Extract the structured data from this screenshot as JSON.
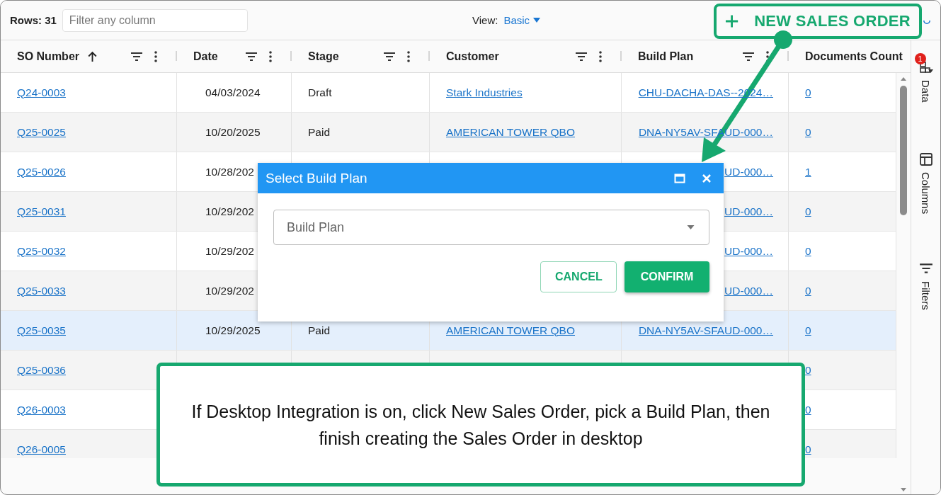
{
  "toolbar": {
    "rows_label": "Rows: 31",
    "filter": {
      "placeholder": "Filter any column"
    },
    "view_label": "View:",
    "view_value": "Basic",
    "new_button": "NEW SALES ORDER"
  },
  "table": {
    "columns": [
      {
        "label": "SO Number",
        "kind": "link",
        "sorted": true,
        "filter": true,
        "menu": true
      },
      {
        "label": "Date",
        "kind": "date",
        "sorted": false,
        "filter": true,
        "menu": true
      },
      {
        "label": "Stage",
        "kind": "text",
        "sorted": false,
        "filter": true,
        "menu": true
      },
      {
        "label": "Customer",
        "kind": "link",
        "sorted": false,
        "filter": true,
        "menu": true
      },
      {
        "label": "Build Plan",
        "kind": "plan",
        "sorted": false,
        "filter": true,
        "menu": true
      },
      {
        "label": "Documents Count",
        "kind": "link",
        "sorted": false,
        "filter": false,
        "menu": false
      }
    ],
    "rows": [
      {
        "selected": false,
        "cells": [
          "Q24-0003",
          "04/03/2024",
          "Draft",
          "Stark Industries",
          "CHU-DACHA-DAS--2024…",
          "0"
        ]
      },
      {
        "selected": false,
        "cells": [
          "Q25-0025",
          "10/20/2025",
          "Paid",
          "AMERICAN TOWER QBO",
          "DNA-NY5AV-SFAUD-000…",
          "0"
        ]
      },
      {
        "selected": false,
        "cells": [
          "Q25-0026",
          "10/28/202",
          null,
          null,
          "UD-000…",
          "1"
        ]
      },
      {
        "selected": false,
        "cells": [
          "Q25-0031",
          "10/29/202",
          null,
          null,
          "UD-000…",
          "0"
        ]
      },
      {
        "selected": false,
        "cells": [
          "Q25-0032",
          "10/29/202",
          null,
          null,
          "UD-000…",
          "0"
        ]
      },
      {
        "selected": false,
        "cells": [
          "Q25-0033",
          "10/29/202",
          null,
          null,
          "UD-000…",
          "0"
        ]
      },
      {
        "selected": true,
        "cells": [
          "Q25-0035",
          "10/29/2025",
          "Paid",
          "AMERICAN TOWER QBO",
          "DNA-NY5AV-SFAUD-000…",
          "0"
        ]
      },
      {
        "selected": false,
        "cells": [
          "Q25-0036",
          null,
          null,
          null,
          null,
          "0"
        ]
      },
      {
        "selected": false,
        "cells": [
          "Q26-0003",
          null,
          null,
          null,
          null,
          "0"
        ]
      },
      {
        "selected": false,
        "cells": [
          "Q26-0005",
          null,
          null,
          null,
          null,
          "0"
        ]
      }
    ]
  },
  "side_panel": {
    "items": [
      {
        "label": "Data",
        "kind": "data",
        "badge": "1"
      },
      {
        "label": "Columns",
        "kind": "columns"
      },
      {
        "label": "Filters",
        "kind": "filters"
      }
    ]
  },
  "dialog": {
    "title": "Select Build Plan",
    "field": {
      "placeholder": "Build Plan"
    },
    "buttons": [
      {
        "label": "CANCEL",
        "kind": "outline"
      },
      {
        "label": "CONFIRM",
        "kind": "primary"
      }
    ]
  },
  "callout": {
    "text": "If Desktop Integration is on, click New Sales Order, pick a Build Plan, then finish creating the Sales Order in desktop"
  }
}
